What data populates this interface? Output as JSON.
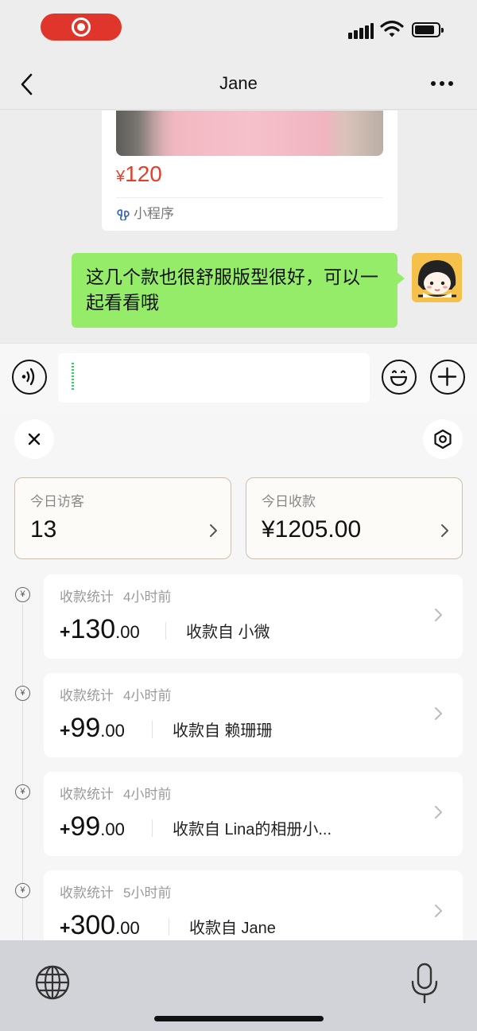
{
  "nav": {
    "title": "Jane"
  },
  "chat": {
    "product": {
      "price": "120",
      "currency": "¥",
      "source_label": "小程序"
    },
    "message": {
      "text": "这几个款也很舒服版型很好，可以一起看看哦"
    }
  },
  "input": {
    "value": "",
    "placeholder": ""
  },
  "panel": {
    "stats": [
      {
        "label": "今日访客",
        "value": "13"
      },
      {
        "label": "今日收款",
        "value": "¥1205.00"
      }
    ],
    "payments": [
      {
        "title": "收款统计",
        "time": "4小时前",
        "sign": "+",
        "integer": "130",
        "decimal": ".00",
        "from": "收款自 小微"
      },
      {
        "title": "收款统计",
        "time": "4小时前",
        "sign": "+",
        "integer": "99",
        "decimal": ".00",
        "from": "收款自 赖珊珊"
      },
      {
        "title": "收款统计",
        "time": "4小时前",
        "sign": "+",
        "integer": "99",
        "decimal": ".00",
        "from": "收款自 Lina的相册小..."
      },
      {
        "title": "收款统计",
        "time": "5小时前",
        "sign": "+",
        "integer": "300",
        "decimal": ".00",
        "from": "收款自 Jane"
      }
    ],
    "timeline_icon": "¥"
  },
  "colors": {
    "bubble": "#95ec69",
    "price": "#e0402e",
    "record": "#e0352b"
  },
  "icons": [
    "record-icon",
    "signal-icon",
    "wifi-icon",
    "battery-icon",
    "back-icon",
    "more-icon",
    "voice-icon",
    "emoji-icon",
    "plus-icon",
    "close-icon",
    "settings-icon",
    "chevron-right-icon",
    "globe-icon",
    "microphone-icon"
  ]
}
